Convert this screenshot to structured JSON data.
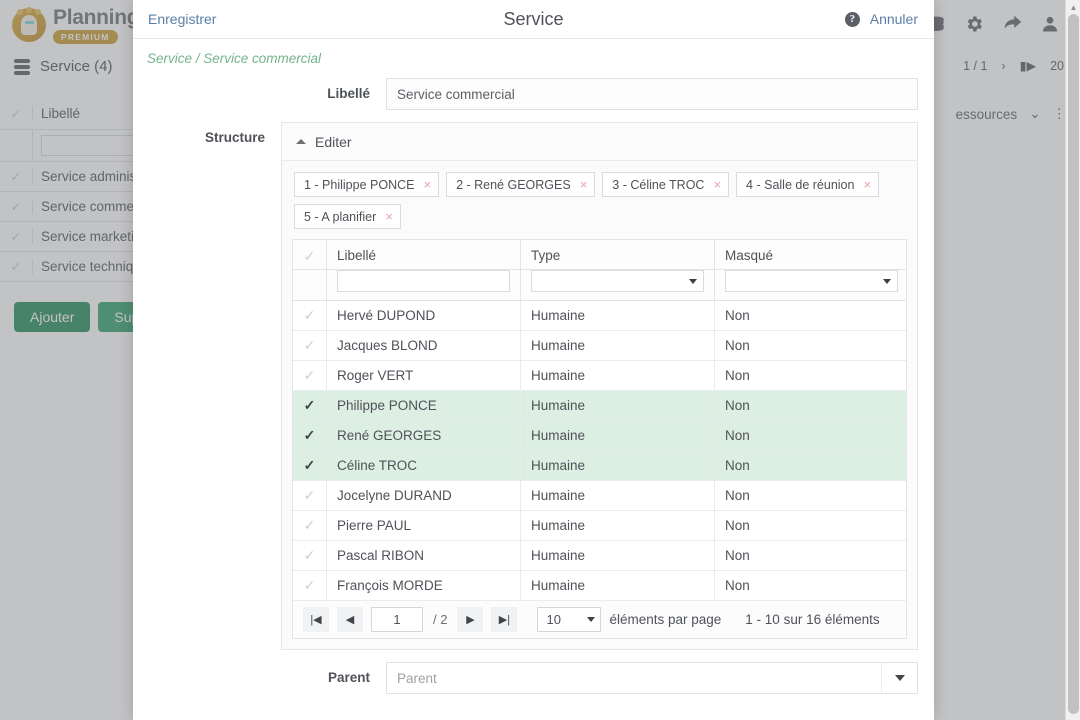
{
  "background": {
    "logo": {
      "name": "Planning",
      "badge": "PREMIUM"
    },
    "section_title": "Service (4)",
    "pager": {
      "page_indicator": "1 / 1",
      "page_size": "20"
    },
    "subbar_label": "essources",
    "table": {
      "column_header": "Libellé",
      "filter_placeholder": "",
      "rows": [
        "Service administ",
        "Service comme",
        "Service marketi",
        "Service techniqu"
      ]
    },
    "buttons": {
      "add": "Ajouter",
      "delete": "Suppr"
    }
  },
  "modal": {
    "header": {
      "save_label": "Enregistrer",
      "title": "Service",
      "cancel_label": "Annuler",
      "help_glyph": "?"
    },
    "breadcrumb": "Service / Service commercial",
    "fields": {
      "libelle_label": "Libellé",
      "libelle_value": "Service commercial",
      "structure_label": "Structure",
      "parent_label": "Parent",
      "parent_placeholder": "Parent"
    },
    "structure": {
      "editer_label": "Editer",
      "chips": [
        {
          "label": "1 - Philippe PONCE",
          "remove": "×"
        },
        {
          "label": "2 - René GEORGES",
          "remove": "×"
        },
        {
          "label": "3 - Céline TROC",
          "remove": "×"
        },
        {
          "label": "4 - Salle de réunion",
          "remove": "×"
        },
        {
          "label": "5 - A planifier",
          "remove": "×"
        }
      ],
      "grid": {
        "columns": [
          "Libellé",
          "Type",
          "Masqué"
        ],
        "filters": {
          "libelle_value": "",
          "type_value": "",
          "masque_value": ""
        },
        "rows": [
          {
            "selected": false,
            "libelle": "Hervé DUPOND",
            "type": "Humaine",
            "masque": "Non"
          },
          {
            "selected": false,
            "libelle": "Jacques BLOND",
            "type": "Humaine",
            "masque": "Non"
          },
          {
            "selected": false,
            "libelle": "Roger VERT",
            "type": "Humaine",
            "masque": "Non"
          },
          {
            "selected": true,
            "libelle": "Philippe PONCE",
            "type": "Humaine",
            "masque": "Non"
          },
          {
            "selected": true,
            "libelle": "René GEORGES",
            "type": "Humaine",
            "masque": "Non"
          },
          {
            "selected": true,
            "libelle": "Céline TROC",
            "type": "Humaine",
            "masque": "Non"
          },
          {
            "selected": false,
            "libelle": "Jocelyne DURAND",
            "type": "Humaine",
            "masque": "Non"
          },
          {
            "selected": false,
            "libelle": "Pierre PAUL",
            "type": "Humaine",
            "masque": "Non"
          },
          {
            "selected": false,
            "libelle": "Pascal RIBON",
            "type": "Humaine",
            "masque": "Non"
          },
          {
            "selected": false,
            "libelle": "François MORDE",
            "type": "Humaine",
            "masque": "Non"
          }
        ],
        "pagination": {
          "first": "|◀",
          "prev": "◀",
          "current_page": "1",
          "total_pages": "/ 2",
          "next": "▶",
          "last": "▶|",
          "page_size": "10",
          "page_size_label": "éléments par page",
          "range_label": "1 - 10 sur 16 éléments"
        }
      }
    }
  },
  "colors": {
    "accent_link": "#5a7fa6",
    "breadcrumb_green": "#74b48c",
    "row_selected": "#ddeee3",
    "brand_green": "#1f8a57",
    "chip_remove": "#e9a3a3"
  }
}
